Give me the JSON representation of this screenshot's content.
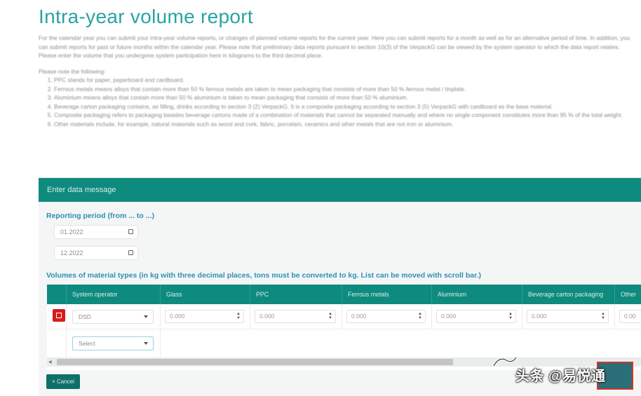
{
  "page": {
    "title": "Intra-year volume report"
  },
  "form": {
    "header": "Enter data message",
    "reporting_period_label": "Reporting period (from ... to ...)",
    "date_from": "01.2022",
    "date_to": "12.2022",
    "volumes_label": "Volumes of material types (in kg with three decimal places, tons must be converted to kg. List can be moved with scroll bar.)",
    "columns": [
      "System operator",
      "Glass",
      "PPC",
      "Ferrous metals",
      "Aluminium",
      "Beverage carton packaging",
      "Other"
    ],
    "row": {
      "system_operator": "DSD",
      "values": [
        "0.000",
        "0.000",
        "0.000",
        "0.000",
        "0.000",
        "0.00"
      ]
    },
    "new_operator_select": "Select",
    "cancel_label": "× Cancel"
  },
  "watermark": {
    "text": "头条 @易悦通"
  },
  "colors": {
    "title": "#2aa3a3",
    "header_bg": "#0f8a7e",
    "delete": "#d91a1a",
    "section_label": "#2f8fb4"
  },
  "icons": [
    "calendar-icon",
    "delete-icon",
    "caret-down-icon",
    "spinner-icon",
    "scroll-left-icon"
  ]
}
